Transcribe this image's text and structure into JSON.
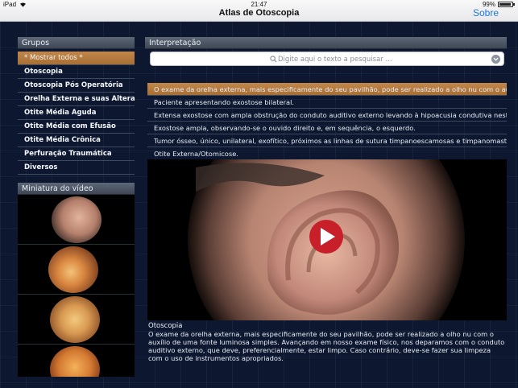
{
  "status_bar": {
    "device": "iPad",
    "time": "21:47",
    "battery": "99%"
  },
  "nav": {
    "title": "Atlas de Otoscopia",
    "right_button": "Sobre"
  },
  "groups": {
    "header": "Grupos",
    "items": [
      {
        "label": "* Mostrar todos *",
        "selected": true
      },
      {
        "label": "Otoscopia"
      },
      {
        "label": "Otoscopia Pós Operatória"
      },
      {
        "label": "Orelha Externa e suas Altera..."
      },
      {
        "label": "Otite Média Aguda"
      },
      {
        "label": "Otite Média com Efusão"
      },
      {
        "label": "Otite Média Crônica"
      },
      {
        "label": "Perfuração Traumática"
      },
      {
        "label": "Diversos"
      }
    ]
  },
  "thumbnails": {
    "header": "Miniatura do vídeo",
    "count": 4
  },
  "interpretation": {
    "header": "Interpretação",
    "search_placeholder": "Digite aqui o texto a pesquisar ...",
    "results": [
      {
        "text": "O exame da orelha externa, mais especificamente do seu pavilhão, pode ser realizado a olho nu com o au...",
        "selected": true
      },
      {
        "text": "Paciente apresentando exostose bilateral."
      },
      {
        "text": "Extensa exostose com ampla obstrução do conduto auditivo externo levando à hipoacusia condutiva neste..."
      },
      {
        "text": "Exostose ampla, observando-se o ouvido direito e, em sequência, o esquerdo."
      },
      {
        "text": "Tumor ósseo, único, unilateral, exofítico, próximos as linhas de sutura timpanoescamosas e timpanomastoi..."
      },
      {
        "text": "Otite Externa/Otomicose."
      }
    ]
  },
  "caption": {
    "title": "Otoscopia",
    "text": "O exame da orelha externa, mais especificamente do seu pavilhão, pode ser realizado a olho nu com o auxílio de uma fonte luminosa simples. Avançando em nosso exame físico, nos deparamos com o conduto auditivo externo, que deve, preferencialmente, estar limpo. Caso contrário, deve-se fazer sua limpeza com o uso de instrumentos apropriados."
  },
  "colors": {
    "selection": "#b57b3f",
    "accent_blue": "#1f78e0",
    "play_button": "#c8202a"
  }
}
